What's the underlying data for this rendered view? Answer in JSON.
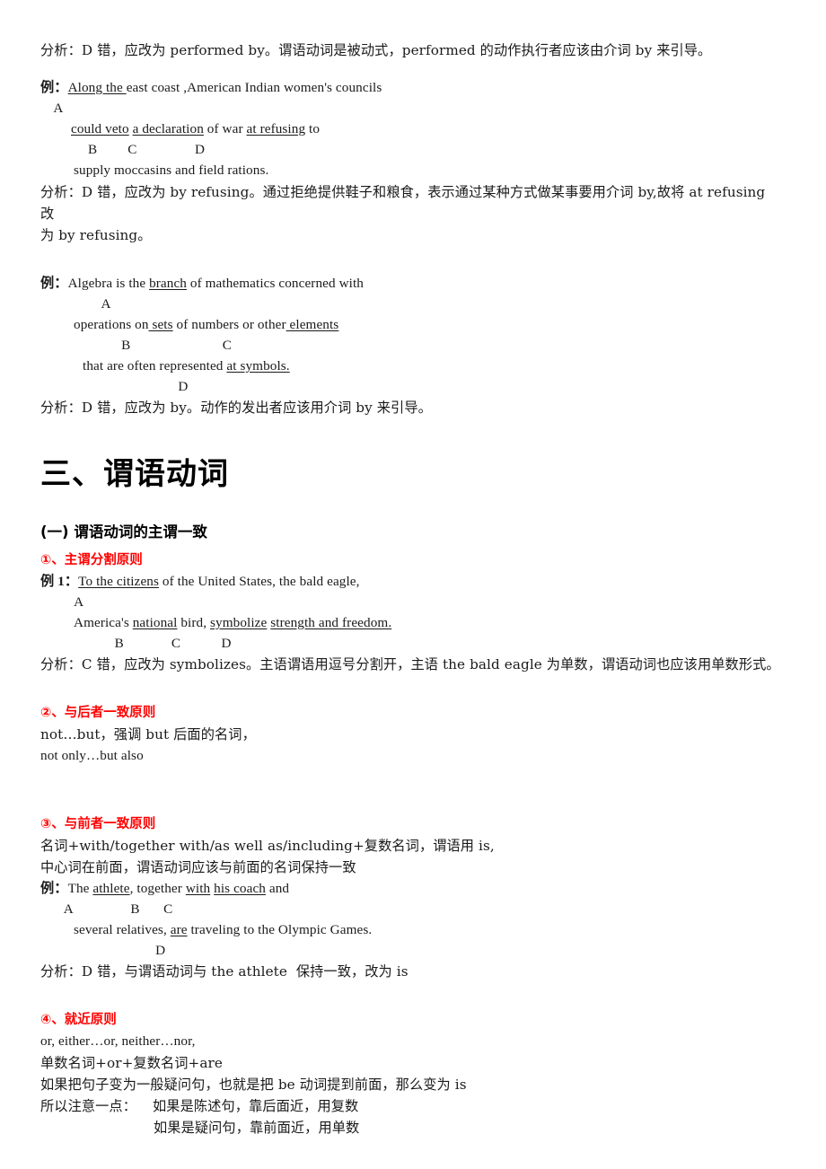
{
  "colors": {
    "text": "#1a1a1a",
    "heading": "#000000",
    "accent_red": "#ff0000"
  },
  "sections": {
    "analysis_1": "分析：D 错，应改为 performed by。谓语动词是被动式，performed 的动作执行者应该由介词 by 来引导。",
    "example_1": {
      "label": "例：",
      "line1_a": "Along the ",
      "line1_b": "east coast ,American Indian women's councils",
      "markers1": "    A",
      "line2_a": "could veto",
      "line2_b": " ",
      "line2_c": "a declaration",
      "line2_d": " of war ",
      "line2_e": "at refusing",
      "line2_f": " to",
      "markers2": "     B         C                 D",
      "line3": "supply moccasins and field rations."
    },
    "analysis_2": "分析：D 错，应改为 by refusing。通过拒绝提供鞋子和粮食，表示通过某种方式做某事要用介词 by,故将 at refusing  改",
    "analysis_2_cont": "为 by refusing。",
    "example_2": {
      "label": "例：",
      "line1_a": "Algebra is the ",
      "line1_b": "branch",
      "line1_c": " of mathematics concerned with",
      "markers1": "                  A",
      "line2_a": "operations on",
      "line2_b": " sets",
      "line2_c": " of numbers or other",
      "line2_d": " elements",
      "markers2": "              B                           C",
      "line3_a": "that are often represented ",
      "line3_b": "at symbols.",
      "markers3": "                            D"
    },
    "analysis_3": "分析：D 错，应改为 by。动作的发出者应该用介词 by 来引导。",
    "main_heading": "三、谓语动词",
    "sub_heading": "(一) 谓语动词的主谓一致",
    "rule_1": {
      "title": "①、主谓分割原则",
      "example_label": "例 1：",
      "line1_a": "To the citizens",
      "line1_b": " of the United States, the bald eagle,",
      "markers1": "          A",
      "line2_a": "America's ",
      "line2_b": "national",
      "line2_c": " bird, ",
      "line2_d": "symbolize",
      "line2_e": " ",
      "line2_f": "strength and freedom.",
      "markers2": "            B              C            D",
      "analysis": "分析：C 错，应改为 symbolizes。主语谓语用逗号分割开，主语 the bald eagle 为单数，谓语动词也应该用单数形式。"
    },
    "rule_2": {
      "title": "②、与后者一致原则",
      "line1": "not…but，强调 but 后面的名词，",
      "line2": "not only…but also"
    },
    "rule_3": {
      "title": "③、与前者一致原则",
      "line1": "名词+with/together with/as well as/including+复数名词，谓语用 is,",
      "line2": "中心词在前面，谓语动词应该与前面的名词保持一致",
      "example_label": "例：",
      "ex_line1_a": "The ",
      "ex_line1_b": "athlete",
      "ex_line1_c": ", together ",
      "ex_line1_d": "with",
      "ex_line1_e": " ",
      "ex_line1_f": "his coach",
      "ex_line1_g": " and",
      "markers1": "       A                 B       C",
      "ex_line2_a": "several relatives, ",
      "ex_line2_b": "are",
      "ex_line2_c": " traveling to the Olympic Games.",
      "markers2": "                        D",
      "analysis": "分析：D 错，与谓语动词与 the athlete  保持一致，改为 is"
    },
    "rule_4": {
      "title": "④、就近原则",
      "line1": "or, either…or, neither…nor,",
      "line2": "单数名词+or+复数名词+are",
      "line3": "如果把句子变为一般疑问句，也就是把 be 动词提到前面，那么变为 is",
      "line4_label": "所以注意一点：",
      "line4_a": "如果是陈述句，靠后面近，用复数",
      "line4_b": "如果是疑问句，靠前面近，用单数"
    }
  }
}
